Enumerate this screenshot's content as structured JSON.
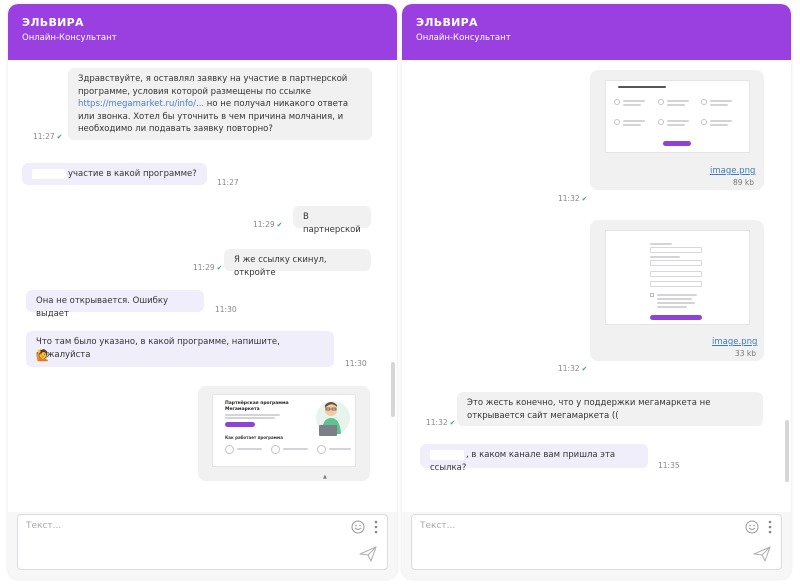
{
  "left": {
    "header": {
      "name": "ЭЛЬВИРА",
      "role": "Онлайн-Консультант"
    },
    "messages": [
      {
        "pre": "Здравствуйте, я оставлял заявку на участие в партнерской программе, условия которой размещены по ссылке ",
        "link": "https://megamarket.ru/info/...",
        "post": " но не получал никакого ответа или звонка. Хотел бы уточнить в чем причина молчания, и необходимо ли подавать заявку повторно?",
        "time": "11:27"
      },
      {
        "text": "участие в какой программе?",
        "time": "11:27"
      },
      {
        "text": "В партнерской",
        "time": "11:29"
      },
      {
        "text": "Я же ссылку скинул, откройте",
        "time": "11:29"
      },
      {
        "text": "Она не открывается. Ошибку выдает",
        "time": "11:30"
      },
      {
        "text": "Что там было указано, в какой программе, напишите, пожалуйста",
        "time": "11:30"
      }
    ],
    "preview": {
      "title": "Партнёрская программа Мегамаркета",
      "section": "Как работает программа"
    },
    "input": {
      "placeholder": "Текст..."
    }
  },
  "right": {
    "header": {
      "name": "ЭЛЬВИРА",
      "role": "Онлайн-Консультант"
    },
    "attachments": [
      {
        "name": "image.png",
        "size": "89 kb",
        "time": "11:32"
      },
      {
        "name": "image.png",
        "size": "33 kb",
        "time": "11:32"
      }
    ],
    "messages": [
      {
        "text": "Это жесть конечно, что у поддержки мегамаркета не открывается сайт мегамаркета ((",
        "time": "11:32"
      },
      {
        "text": ", в каком канале вам пришла эта ссылка?",
        "time": "11:35"
      }
    ],
    "input": {
      "placeholder": "Текст..."
    }
  },
  "colors": {
    "header": "#9a3fe0",
    "incoming_bubble": "#f0eefb",
    "outgoing_bubble": "#f1f1f2",
    "read_check": "#3aa88c",
    "file_link": "#3c7bbf"
  }
}
